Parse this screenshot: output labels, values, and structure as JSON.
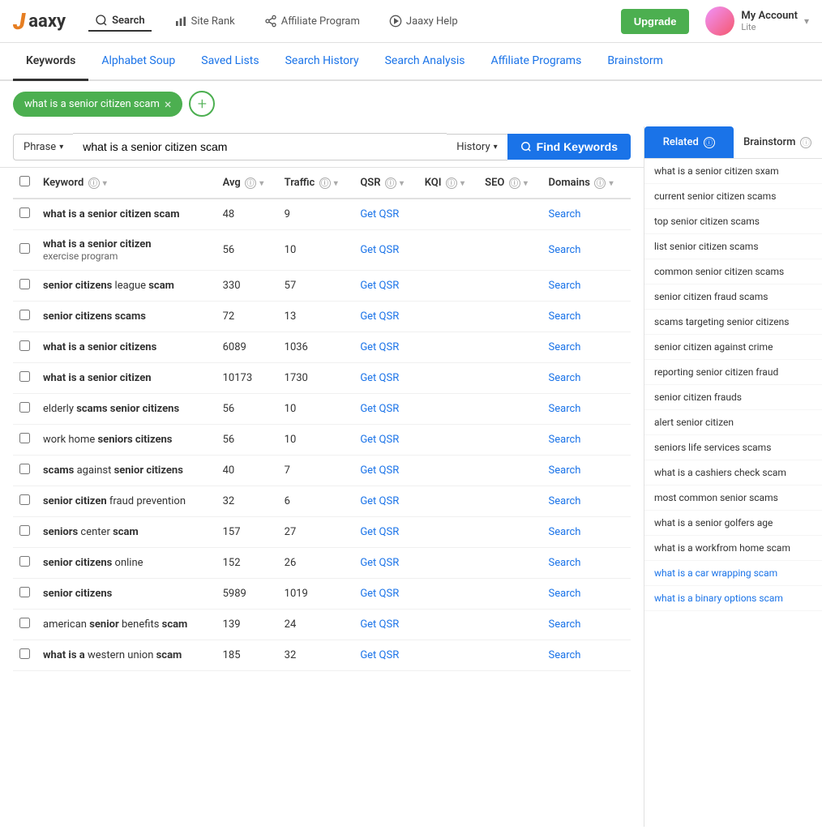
{
  "logo": {
    "brand": "Jaaxy"
  },
  "header": {
    "nav": [
      {
        "id": "search",
        "label": "Search",
        "icon": "search-icon",
        "active": true
      },
      {
        "id": "siterank",
        "label": "Site Rank",
        "icon": "bar-chart-icon",
        "active": false
      },
      {
        "id": "affiliate",
        "label": "Affiliate Program",
        "icon": "share-icon",
        "active": false
      },
      {
        "id": "help",
        "label": "Jaaxy Help",
        "icon": "play-circle-icon",
        "active": false
      }
    ],
    "upgrade_label": "Upgrade",
    "account": {
      "name": "My Account",
      "tier": "Lite",
      "chevron": "▾"
    }
  },
  "tabs": [
    {
      "id": "keywords",
      "label": "Keywords",
      "active": true
    },
    {
      "id": "alphabet",
      "label": "Alphabet Soup",
      "active": false
    },
    {
      "id": "saved",
      "label": "Saved Lists",
      "active": false
    },
    {
      "id": "history",
      "label": "Search History",
      "active": false
    },
    {
      "id": "analysis",
      "label": "Search Analysis",
      "active": false
    },
    {
      "id": "programs",
      "label": "Affiliate Programs",
      "active": false
    },
    {
      "id": "brainstorm",
      "label": "Brainstorm",
      "active": false
    }
  ],
  "search_tag": {
    "label": "what is a senior citizen scam",
    "close_icon": "×"
  },
  "add_tag_icon": "+",
  "search_bar": {
    "phrase_label": "Phrase",
    "chevron": "▾",
    "input_value": "what is a senior citizen scam",
    "history_label": "History",
    "find_label": "Find Keywords",
    "search_icon": "🔍"
  },
  "table": {
    "columns": [
      {
        "id": "checkbox",
        "label": ""
      },
      {
        "id": "keyword",
        "label": "Keyword",
        "info": true,
        "sort": true
      },
      {
        "id": "avg",
        "label": "Avg",
        "info": true,
        "sort": true
      },
      {
        "id": "traffic",
        "label": "Traffic",
        "info": true,
        "sort": true
      },
      {
        "id": "qsr",
        "label": "QSR",
        "info": true,
        "sort": true
      },
      {
        "id": "kqi",
        "label": "KQI",
        "info": true,
        "sort": true
      },
      {
        "id": "seo",
        "label": "SEO",
        "info": true,
        "sort": true
      },
      {
        "id": "domains",
        "label": "Domains",
        "info": true,
        "sort": true
      }
    ],
    "rows": [
      {
        "keyword": "what is a senior citizen scam",
        "keyword_bold": [
          "what is a senior citizen scam"
        ],
        "sub": "",
        "avg": "48",
        "traffic": "9",
        "qsr": "",
        "kqi": "",
        "seo": "",
        "domains": "Search",
        "get_qsr": "Get QSR"
      },
      {
        "keyword": "what is a senior citizen exercise program",
        "keyword_bold": [
          "what is a senior citizen"
        ],
        "sub": "exercise program",
        "avg": "56",
        "traffic": "10",
        "qsr": "",
        "kqi": "",
        "seo": "",
        "domains": "Search",
        "get_qsr": "Get QSR"
      },
      {
        "keyword": "senior citizens league scam",
        "keyword_bold": [
          "senior citizens",
          "scam"
        ],
        "sub": "",
        "avg": "330",
        "traffic": "57",
        "qsr": "",
        "kqi": "",
        "seo": "",
        "domains": "Search",
        "get_qsr": "Get QSR"
      },
      {
        "keyword": "senior citizens scams",
        "keyword_bold": [
          "senior citizens scams"
        ],
        "sub": "",
        "avg": "72",
        "traffic": "13",
        "qsr": "",
        "kqi": "",
        "seo": "",
        "domains": "Search",
        "get_qsr": "Get QSR"
      },
      {
        "keyword": "what is a senior citizens",
        "keyword_bold": [
          "what is a senior citizens"
        ],
        "sub": "",
        "avg": "6089",
        "traffic": "1036",
        "qsr": "",
        "kqi": "",
        "seo": "",
        "domains": "Search",
        "get_qsr": "Get QSR"
      },
      {
        "keyword": "what is a senior citizen",
        "keyword_bold": [
          "what is a senior citizen"
        ],
        "sub": "",
        "avg": "10173",
        "traffic": "1730",
        "qsr": "",
        "kqi": "",
        "seo": "",
        "domains": "Search",
        "get_qsr": "Get QSR"
      },
      {
        "keyword": "elderly scams senior citizens",
        "keyword_bold": [
          "scams senior citizens"
        ],
        "sub": "",
        "avg": "56",
        "traffic": "10",
        "qsr": "",
        "kqi": "",
        "seo": "",
        "domains": "Search",
        "get_qsr": "Get QSR"
      },
      {
        "keyword": "work home seniors citizens",
        "keyword_bold": [
          "seniors citizens"
        ],
        "sub": "",
        "avg": "56",
        "traffic": "10",
        "qsr": "",
        "kqi": "",
        "seo": "",
        "domains": "Search",
        "get_qsr": "Get QSR"
      },
      {
        "keyword": "scams against senior citizens",
        "keyword_bold": [
          "scams",
          "senior citizens"
        ],
        "sub": "",
        "avg": "40",
        "traffic": "7",
        "qsr": "",
        "kqi": "",
        "seo": "",
        "domains": "Search",
        "get_qsr": "Get QSR"
      },
      {
        "keyword": "senior citizen fraud prevention",
        "keyword_bold": [
          "senior citizen"
        ],
        "sub": "",
        "avg": "32",
        "traffic": "6",
        "qsr": "",
        "kqi": "",
        "seo": "",
        "domains": "Search",
        "get_qsr": "Get QSR"
      },
      {
        "keyword": "seniors center scam",
        "keyword_bold": [
          "seniors",
          "scam"
        ],
        "sub": "",
        "avg": "157",
        "traffic": "27",
        "qsr": "",
        "kqi": "",
        "seo": "",
        "domains": "Search",
        "get_qsr": "Get QSR"
      },
      {
        "keyword": "senior citizens online",
        "keyword_bold": [
          "senior citizens"
        ],
        "sub": "",
        "avg": "152",
        "traffic": "26",
        "qsr": "",
        "kqi": "",
        "seo": "",
        "domains": "Search",
        "get_qsr": "Get QSR"
      },
      {
        "keyword": "senior citizens",
        "keyword_bold": [
          "senior citizens"
        ],
        "sub": "",
        "avg": "5989",
        "traffic": "1019",
        "qsr": "",
        "kqi": "",
        "seo": "",
        "domains": "Search",
        "get_qsr": "Get QSR"
      },
      {
        "keyword": "american senior benefits scam",
        "keyword_bold": [
          "senior",
          "scam"
        ],
        "sub": "",
        "avg": "139",
        "traffic": "24",
        "qsr": "",
        "kqi": "",
        "seo": "",
        "domains": "Search",
        "get_qsr": "Get QSR"
      },
      {
        "keyword": "what is a western union scam",
        "keyword_bold": [
          "what is a",
          "scam"
        ],
        "sub": "",
        "avg": "185",
        "traffic": "32",
        "qsr": "",
        "kqi": "",
        "seo": "",
        "domains": "Search",
        "get_qsr": "Get QSR"
      }
    ]
  },
  "right_panel": {
    "tab_related": "Related",
    "tab_brainstorm": "Brainstorm",
    "active_tab": "related",
    "related_items": [
      "what is a senior citizen sxam",
      "current senior citizen scams",
      "top senior citizen scams",
      "list senior citizen scams",
      "common senior citizen scams",
      "senior citizen fraud scams",
      "scams targeting senior citizens",
      "senior citizen against crime",
      "reporting senior citizen fraud",
      "senior citizen frauds",
      "alert senior citizen",
      "seniors life services scams",
      "what is a cashiers check scam",
      "most common senior scams",
      "what is a senior golfers age",
      "what is a workfrom home scam",
      "what is a car wrapping scam",
      "what is a binary options scam"
    ]
  },
  "keywords_display": [
    {
      "parts": [
        {
          "text": "what is a senior citizen scam",
          "bold": true
        }
      ],
      "sub": null,
      "avg": "48",
      "traffic": "9"
    },
    {
      "parts": [
        {
          "text": "what is a senior citizen",
          "bold": true
        },
        {
          "text": " ",
          "bold": false
        }
      ],
      "sub": "exercise program",
      "avg": "56",
      "traffic": "10"
    },
    {
      "parts": [
        {
          "text": "senior citizens",
          "bold": true
        },
        {
          "text": " league ",
          "bold": false
        },
        {
          "text": "scam",
          "bold": true
        }
      ],
      "sub": null,
      "avg": "330",
      "traffic": "57"
    },
    {
      "parts": [
        {
          "text": "senior citizens scams",
          "bold": true
        }
      ],
      "sub": null,
      "avg": "72",
      "traffic": "13"
    },
    {
      "parts": [
        {
          "text": "what is a senior citizens",
          "bold": true
        }
      ],
      "sub": null,
      "avg": "6089",
      "traffic": "1036"
    },
    {
      "parts": [
        {
          "text": "what is a senior citizen",
          "bold": true
        }
      ],
      "sub": null,
      "avg": "10173",
      "traffic": "1730"
    },
    {
      "parts": [
        {
          "text": "elderly ",
          "bold": false
        },
        {
          "text": "scams senior citizens",
          "bold": true
        }
      ],
      "sub": null,
      "avg": "56",
      "traffic": "10"
    },
    {
      "parts": [
        {
          "text": "work home ",
          "bold": false
        },
        {
          "text": "seniors citizens",
          "bold": true
        }
      ],
      "sub": null,
      "avg": "56",
      "traffic": "10"
    },
    {
      "parts": [
        {
          "text": "scams",
          "bold": true
        },
        {
          "text": " against ",
          "bold": false
        },
        {
          "text": "senior citizens",
          "bold": true
        }
      ],
      "sub": null,
      "avg": "40",
      "traffic": "7"
    },
    {
      "parts": [
        {
          "text": "senior citizen",
          "bold": true
        },
        {
          "text": " fraud prevention",
          "bold": false
        }
      ],
      "sub": null,
      "avg": "32",
      "traffic": "6"
    },
    {
      "parts": [
        {
          "text": "seniors",
          "bold": true
        },
        {
          "text": " center ",
          "bold": false
        },
        {
          "text": "scam",
          "bold": true
        }
      ],
      "sub": null,
      "avg": "157",
      "traffic": "27"
    },
    {
      "parts": [
        {
          "text": "senior citizens",
          "bold": true
        },
        {
          "text": " online",
          "bold": false
        }
      ],
      "sub": null,
      "avg": "152",
      "traffic": "26"
    },
    {
      "parts": [
        {
          "text": "senior citizens",
          "bold": true
        }
      ],
      "sub": null,
      "avg": "5989",
      "traffic": "1019"
    },
    {
      "parts": [
        {
          "text": "american ",
          "bold": false
        },
        {
          "text": "senior",
          "bold": true
        },
        {
          "text": " benefits ",
          "bold": false
        },
        {
          "text": "scam",
          "bold": true
        }
      ],
      "sub": null,
      "avg": "139",
      "traffic": "24"
    },
    {
      "parts": [
        {
          "text": "what is a",
          "bold": true
        },
        {
          "text": " western union ",
          "bold": false
        },
        {
          "text": "scam",
          "bold": true
        }
      ],
      "sub": null,
      "avg": "185",
      "traffic": "32"
    }
  ]
}
